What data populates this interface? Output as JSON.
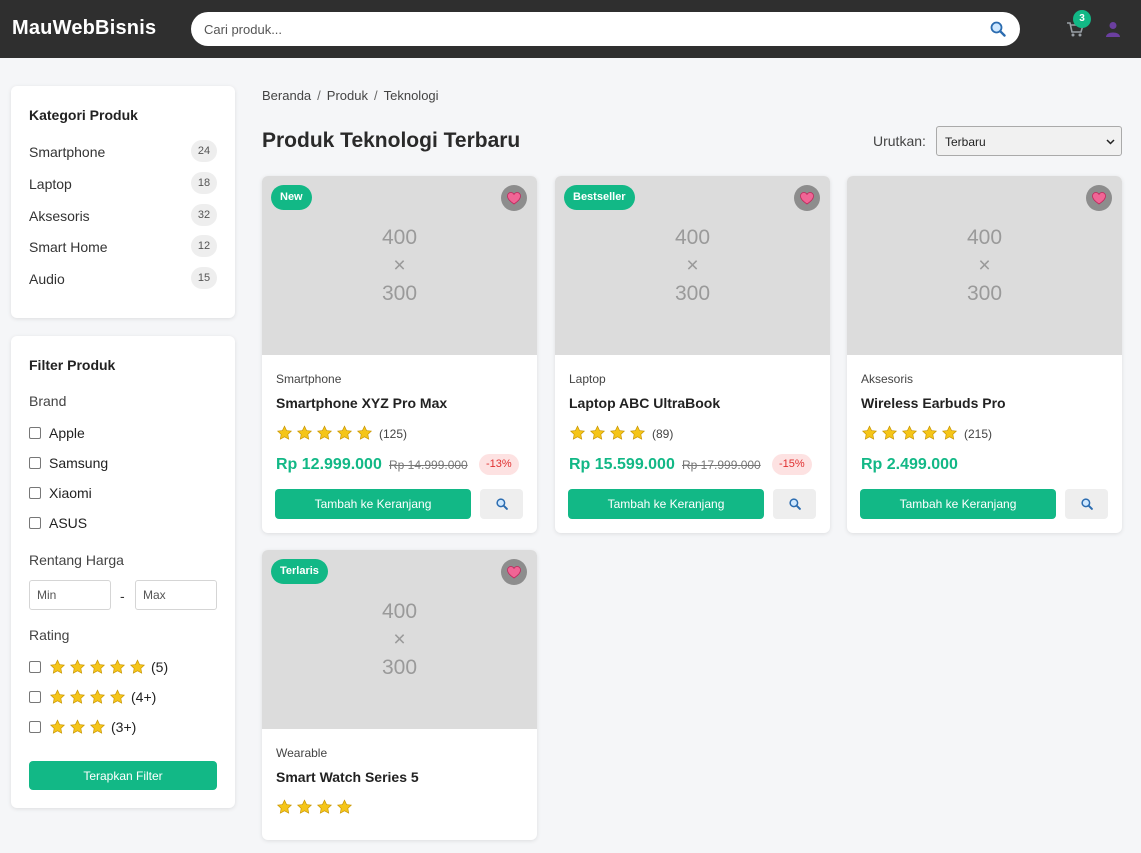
{
  "header": {
    "logo": "MauWebBisnis",
    "search_placeholder": "Cari produk...",
    "cart_count": "3",
    "icons": [
      "search-icon",
      "cart-icon",
      "user-icon"
    ]
  },
  "sidebar": {
    "categories": {
      "title": "Kategori Produk",
      "items": [
        {
          "label": "Smartphone",
          "count": "24"
        },
        {
          "label": "Laptop",
          "count": "18"
        },
        {
          "label": "Aksesoris",
          "count": "32"
        },
        {
          "label": "Smart Home",
          "count": "12"
        },
        {
          "label": "Audio",
          "count": "15"
        }
      ]
    },
    "filter": {
      "title": "Filter Produk",
      "brand_title": "Brand",
      "brands": [
        "Apple",
        "Samsung",
        "Xiaomi",
        "ASUS"
      ],
      "price_title": "Rentang Harga",
      "min_placeholder": "Min",
      "dash": "-",
      "max_placeholder": "Max",
      "rating_title": "Rating",
      "ratings": [
        {
          "stars": 5,
          "label": "(5)"
        },
        {
          "stars": 4,
          "label": "(4+)"
        },
        {
          "stars": 3,
          "label": "(3+)"
        }
      ],
      "apply_label": "Terapkan Filter"
    }
  },
  "main": {
    "breadcrumb": [
      "Beranda",
      "Produk",
      "Teknologi"
    ],
    "breadcrumb_sep": "/",
    "title": "Produk Teknologi Terbaru",
    "sort_label": "Urutkan:",
    "sort_value": "Terbaru",
    "placeholder_lines": [
      "400",
      "×",
      "300"
    ],
    "add_to_cart_label": "Tambah ke Keranjang",
    "products": [
      {
        "badge": "New",
        "category": "Smartphone",
        "name": "Smartphone XYZ Pro Max",
        "stars": 5,
        "reviews": "(125)",
        "price": "Rp 12.999.000",
        "old_price": "Rp 14.999.000",
        "discount": "-13%"
      },
      {
        "badge": "Bestseller",
        "category": "Laptop",
        "name": "Laptop ABC UltraBook",
        "stars": 4,
        "reviews": "(89)",
        "price": "Rp 15.599.000",
        "old_price": "Rp 17.999.000",
        "discount": "-15%"
      },
      {
        "badge": "",
        "category": "Aksesoris",
        "name": "Wireless Earbuds Pro",
        "stars": 5,
        "reviews": "(215)",
        "price": "Rp 2.499.000",
        "old_price": "",
        "discount": ""
      },
      {
        "badge": "Terlaris",
        "category": "Wearable",
        "name": "Smart Watch Series 5",
        "stars": 4,
        "reviews": "",
        "price": "",
        "old_price": "",
        "discount": ""
      }
    ]
  },
  "colors": {
    "accent": "#12b886",
    "header_bg": "#2f2f2f",
    "star": "#f5c518",
    "discount_text": "#e03131",
    "discount_bg": "#fde2e2"
  }
}
